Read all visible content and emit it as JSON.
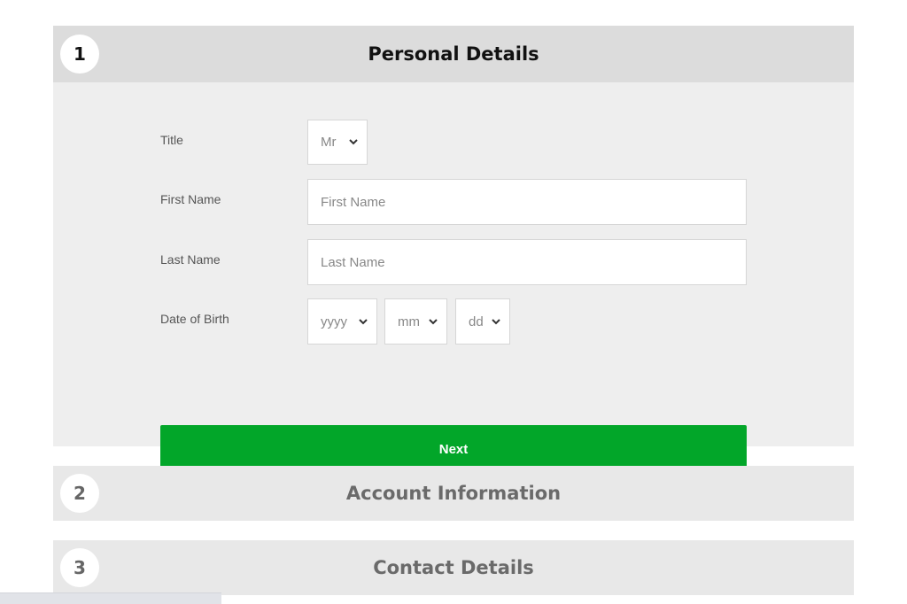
{
  "sections": [
    {
      "number": "1",
      "title": "Personal Details"
    },
    {
      "number": "2",
      "title": "Account Information"
    },
    {
      "number": "3",
      "title": "Contact Details"
    }
  ],
  "form": {
    "title_label": "Title",
    "title_value": "Mr",
    "first_name_label": "First Name",
    "first_name_placeholder": "First Name",
    "last_name_label": "Last Name",
    "last_name_placeholder": "Last Name",
    "dob_label": "Date of Birth",
    "dob_year": "yyyy",
    "dob_month": "mm",
    "dob_day": "dd",
    "next_label": "Next"
  },
  "colors": {
    "accent": "#02a629"
  }
}
